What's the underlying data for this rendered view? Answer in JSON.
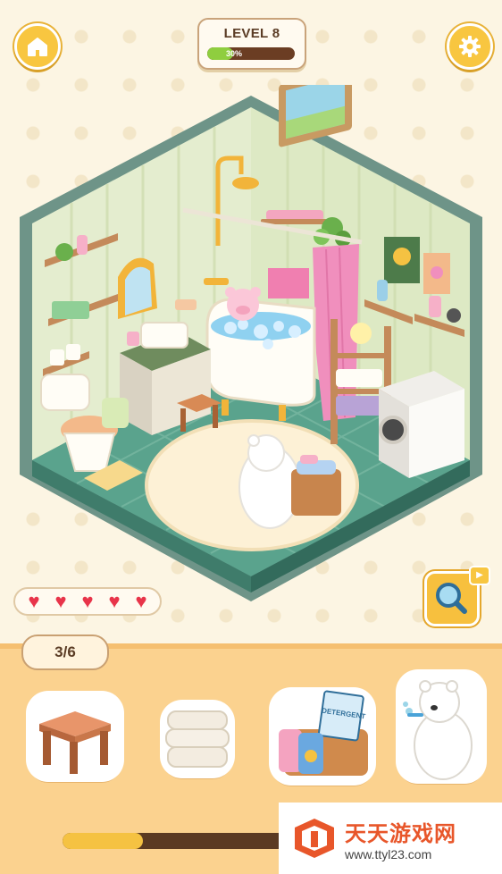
{
  "header": {
    "level_label": "LEVEL 8",
    "progress_percent": 30,
    "progress_text": "30%",
    "home_icon": "home-icon",
    "settings_icon": "gear-icon"
  },
  "hearts": {
    "count": 5,
    "icon": "heart-icon",
    "color": "#e8344a"
  },
  "hint_button": {
    "icon": "magnifier-icon",
    "badge_icon": "video-play-icon"
  },
  "tray": {
    "counter": "3/6",
    "items": [
      {
        "name": "wooden-stool"
      },
      {
        "name": "folded-towels"
      },
      {
        "name": "detergent-basket",
        "label": "DETERGENT"
      },
      {
        "name": "bear-brushing-teeth"
      }
    ],
    "bottom_progress_fraction": 0.36
  },
  "watermark": {
    "title": "天天游戏网",
    "url": "www.ttyl23.com"
  },
  "colors": {
    "accent_yellow": "#f8c640",
    "progress_green": "#8fce3f",
    "panel_orange": "#fbd28f",
    "floor_green": "#5aa38d"
  }
}
